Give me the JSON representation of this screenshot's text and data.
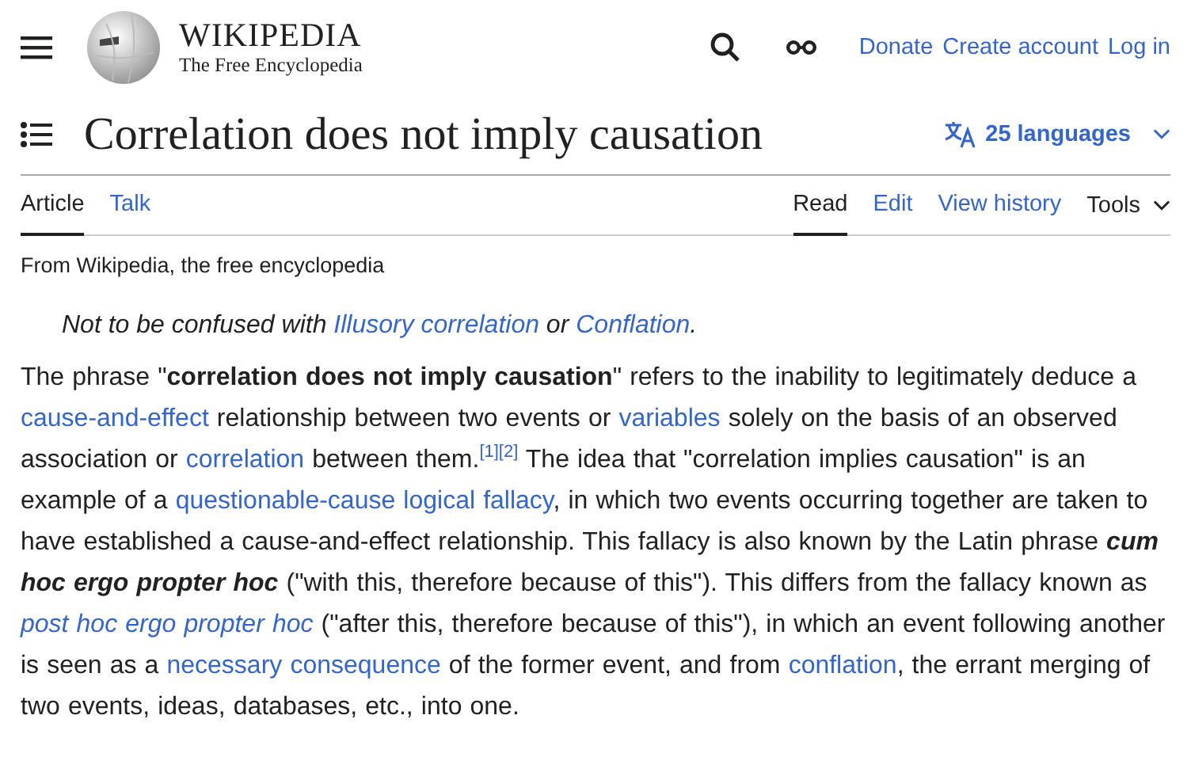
{
  "header": {
    "logo": {
      "wordmark": "WIKIPEDIA",
      "tagline": "The Free Encyclopedia"
    },
    "links": [
      "Donate",
      "Create account",
      "Log in"
    ]
  },
  "title": "Correlation does not imply causation",
  "languages": "25 languages",
  "left_tabs": [
    {
      "label": "Article",
      "selected": true
    },
    {
      "label": "Talk",
      "selected": false
    }
  ],
  "right_tabs": [
    {
      "label": "Read",
      "selected": true
    },
    {
      "label": "Edit",
      "selected": false
    },
    {
      "label": "View history",
      "selected": false
    }
  ],
  "tools_menu": "Tools",
  "tagline": "From Wikipedia, the free encyclopedia",
  "hatnote": [
    {
      "kind": "text",
      "text": "Not to be confused with "
    },
    {
      "kind": "link",
      "text": "Illusory correlation"
    },
    {
      "kind": "text",
      "text": " or "
    },
    {
      "kind": "link",
      "text": "Conflation"
    },
    {
      "kind": "text",
      "text": "."
    }
  ],
  "paragraph": [
    {
      "kind": "text",
      "text": "The phrase \""
    },
    {
      "kind": "bold",
      "text": "correlation does not imply causation"
    },
    {
      "kind": "text",
      "text": "\" refers to the inability to legitimately deduce a "
    },
    {
      "kind": "link",
      "text": "cause-and-effect"
    },
    {
      "kind": "text",
      "text": " relationship between two events or "
    },
    {
      "kind": "link",
      "text": "variables"
    },
    {
      "kind": "text",
      "text": " solely on the basis of an observed association or "
    },
    {
      "kind": "link",
      "text": "correlation"
    },
    {
      "kind": "text",
      "text": " between them."
    },
    {
      "kind": "ref",
      "text": "[1]"
    },
    {
      "kind": "ref",
      "text": "[2]"
    },
    {
      "kind": "text",
      "text": " The idea that \"correlation implies causation\" is an example of a "
    },
    {
      "kind": "link",
      "text": "questionable-cause logical fallacy"
    },
    {
      "kind": "text",
      "text": ", in which two events occurring together are taken to have established a cause-and-effect relationship. This fallacy is also known by the Latin phrase "
    },
    {
      "kind": "bolditalic",
      "text": "cum hoc ergo propter hoc"
    },
    {
      "kind": "text",
      "text": " (\"with this, therefore because of this\"). This differs from the fallacy known as "
    },
    {
      "kind": "italiclink",
      "text": "post hoc ergo propter hoc"
    },
    {
      "kind": "text",
      "text": " (\"after this, therefore because of this\"), in which an event following another is seen as a "
    },
    {
      "kind": "link",
      "text": "necessary consequence"
    },
    {
      "kind": "text",
      "text": " of the former event, and from "
    },
    {
      "kind": "link",
      "text": "conflation"
    },
    {
      "kind": "text",
      "text": ", the errant merging of two events, ideas, databases, etc., into one."
    }
  ]
}
